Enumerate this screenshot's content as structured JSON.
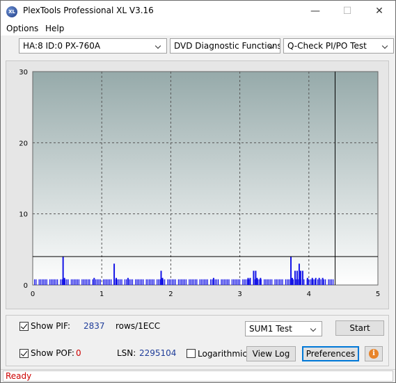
{
  "window": {
    "title": "PlexTools Professional XL V3.16",
    "icon_label": "XL",
    "controls": {
      "minimize": "—",
      "maximize": "☐",
      "close": "✕"
    }
  },
  "menu": {
    "options": "Options",
    "help": "Help"
  },
  "toolbar": {
    "drive": "HA:8 ID:0  PX-760A",
    "function": "DVD Diagnostic Functions",
    "test": "Q-Check PI/PO Test"
  },
  "colors": {
    "bar": "#1515e6",
    "threshold_line": "#000000",
    "plot_top": "#96aaaa",
    "plot_bottom": "#ffffff",
    "status_text": "#cc0000"
  },
  "chart_data": {
    "type": "bar",
    "xlim": [
      0,
      5
    ],
    "ylim": [
      0,
      30
    ],
    "xticks": [
      "0",
      "1",
      "2",
      "3",
      "4",
      "5"
    ],
    "yticks": [
      "0",
      "10",
      "20",
      "30"
    ],
    "grid": true,
    "threshold": 4,
    "end_marker_x": 4.38,
    "baseline_band": [
      0.02,
      4.36
    ],
    "spikes": [
      {
        "x": 0.44,
        "y": 4
      },
      {
        "x": 0.46,
        "y": 1
      },
      {
        "x": 0.89,
        "y": 1
      },
      {
        "x": 1.18,
        "y": 3
      },
      {
        "x": 1.21,
        "y": 1
      },
      {
        "x": 1.38,
        "y": 1
      },
      {
        "x": 1.86,
        "y": 2
      },
      {
        "x": 1.88,
        "y": 1
      },
      {
        "x": 2.62,
        "y": 1
      },
      {
        "x": 3.12,
        "y": 1
      },
      {
        "x": 3.15,
        "y": 1
      },
      {
        "x": 3.2,
        "y": 2
      },
      {
        "x": 3.23,
        "y": 2
      },
      {
        "x": 3.25,
        "y": 1
      },
      {
        "x": 3.3,
        "y": 1
      },
      {
        "x": 3.74,
        "y": 4
      },
      {
        "x": 3.76,
        "y": 1
      },
      {
        "x": 3.8,
        "y": 2
      },
      {
        "x": 3.83,
        "y": 2
      },
      {
        "x": 3.86,
        "y": 3
      },
      {
        "x": 3.88,
        "y": 2
      },
      {
        "x": 3.91,
        "y": 2
      },
      {
        "x": 3.98,
        "y": 1
      },
      {
        "x": 4.05,
        "y": 1
      },
      {
        "x": 4.1,
        "y": 1
      },
      {
        "x": 4.15,
        "y": 1
      },
      {
        "x": 4.2,
        "y": 1
      }
    ]
  },
  "bottom": {
    "show_pif_label": "Show PIF:",
    "pif_value": "2837",
    "rows_label": "rows/1ECC",
    "show_pof_label": "Show POF:",
    "pof_value": "0",
    "lsn_label": "LSN:",
    "lsn_value": "2295104",
    "logarithmic_label": "Logarithmic",
    "sum_select": "SUM1 Test",
    "start_button": "Start",
    "viewlog_button": "View Log",
    "preferences_button": "Preferences",
    "info_icon": "i"
  },
  "status": {
    "text": "Ready"
  }
}
